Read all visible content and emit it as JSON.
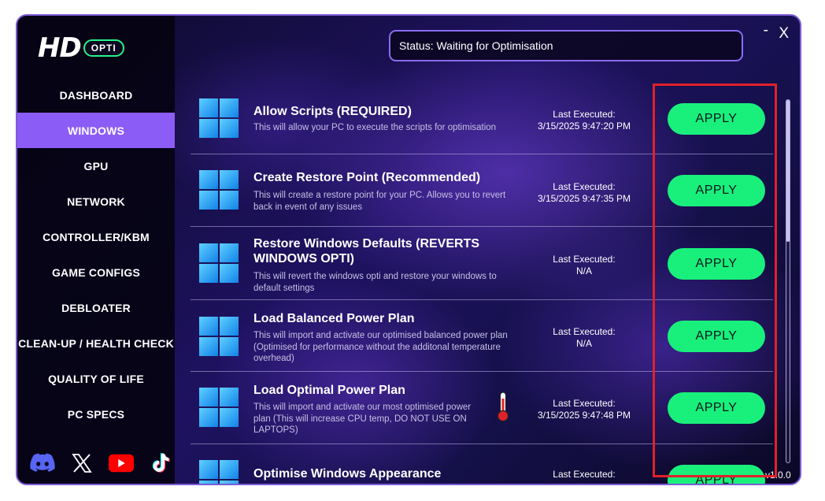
{
  "app": {
    "logo_hd": "HD",
    "logo_opti": "OPTI",
    "status": "Status: Waiting for Optimisation",
    "minimize": "-",
    "close": "X",
    "version": "v1.0.0"
  },
  "sidebar": {
    "items": [
      {
        "label": "DASHBOARD"
      },
      {
        "label": "WINDOWS"
      },
      {
        "label": "GPU"
      },
      {
        "label": "NETWORK"
      },
      {
        "label": "CONTROLLER/KBM"
      },
      {
        "label": "GAME CONFIGS"
      },
      {
        "label": "DEBLOATER"
      },
      {
        "label": "CLEAN-UP / HEALTH CHECK"
      },
      {
        "label": "QUALITY OF LIFE"
      },
      {
        "label": "PC SPECS"
      }
    ],
    "active_item": "WINDOWS",
    "socials": [
      "discord-icon",
      "x-icon",
      "youtube-icon",
      "tiktok-icon"
    ]
  },
  "tweaks": [
    {
      "title": "Allow Scripts (REQUIRED)",
      "description": "This will allow your PC to execute the scripts for optimisation",
      "last_executed_label": "Last Executed:",
      "last_executed": "3/15/2025 9:47:20 PM",
      "button": "APPLY"
    },
    {
      "title": "Create Restore Point (Recommended)",
      "description": "This will create a restore point for your PC. Allows you to revert back in event of any issues",
      "last_executed_label": "Last Executed:",
      "last_executed": "3/15/2025 9:47:35 PM",
      "button": "APPLY"
    },
    {
      "title": "Restore Windows Defaults (REVERTS WINDOWS OPTI)",
      "description": "This will revert the windows opti and restore your windows to default settings",
      "last_executed_label": "Last Executed:",
      "last_executed": "N/A",
      "button": "APPLY"
    },
    {
      "title": "Load Balanced Power Plan",
      "description": "This will import and activate our optimised balanced power plan (Optimised for performance without the additonal temperature overhead)",
      "last_executed_label": "Last Executed:",
      "last_executed": "N/A",
      "button": "APPLY"
    },
    {
      "title": "Load Optimal Power Plan",
      "description": "This will import and activate our most optimised power plan (This will increase CPU temp, DO NOT USE ON LAPTOPS)",
      "last_executed_label": "Last Executed:",
      "last_executed": "3/15/2025 9:47:48 PM",
      "button": "APPLY",
      "icon": "thermometer-icon"
    },
    {
      "title": "Optimise Windows Appearance",
      "description": "",
      "last_executed_label": "Last Executed:",
      "last_executed": "",
      "button": "APPLY"
    }
  ],
  "colors": {
    "accent": "#8c5cf6",
    "apply_button": "#19f07c",
    "highlight_box": "#e0212a"
  }
}
